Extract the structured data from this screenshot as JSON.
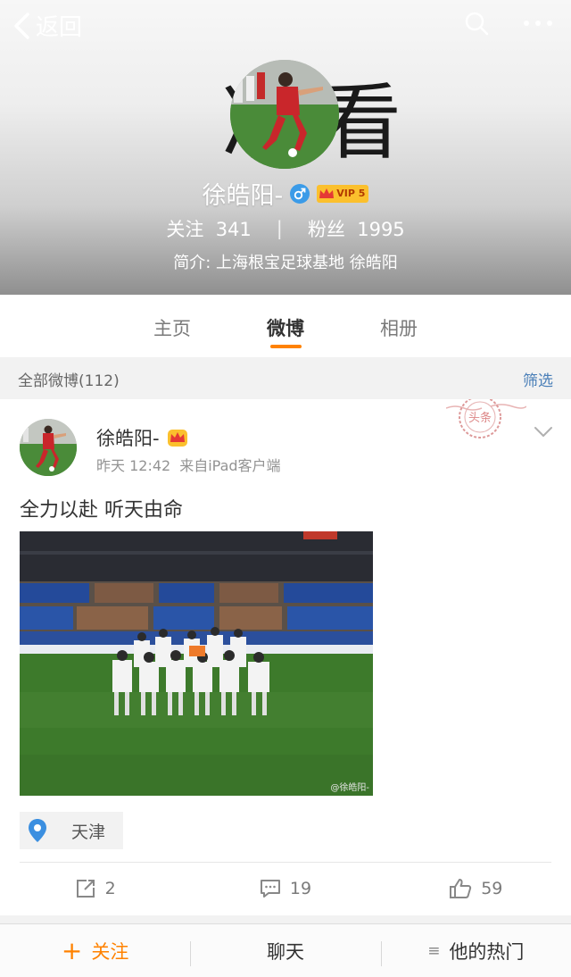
{
  "header": {
    "back_label": "返回",
    "bg_text": "准看",
    "name": "徐皓阳-",
    "vip_label": "VIP 5",
    "follow_label": "关注",
    "follow_count": "341",
    "fans_label": "粉丝",
    "fans_count": "1995",
    "bio": "简介: 上海根宝足球基地 徐皓阳"
  },
  "tabs": [
    {
      "label": "主页"
    },
    {
      "label": "微博"
    },
    {
      "label": "相册"
    }
  ],
  "filter": {
    "title": "全部微博(112)",
    "button": "筛选"
  },
  "post": {
    "author": "徐皓阳-",
    "time": "昨天 12:42",
    "source": "来自iPad客户端",
    "stamp_text": "头条",
    "text": "全力以赴 听天由命",
    "watermark": "@徐皓阳-",
    "location": "天津",
    "reposts": "2",
    "comments": "19",
    "likes": "59"
  },
  "bottom": {
    "follow_label": "关注",
    "chat_label": "聊天",
    "hot_label": "他的热门"
  },
  "colors": {
    "accent": "#ff8200",
    "link": "#4a7fb8",
    "gender": "#3b9be8",
    "vip": "#fbc02d"
  },
  "icons": [
    "back-arrow-icon",
    "search-icon",
    "more-icon",
    "male-icon",
    "crown-icon",
    "location-pin-icon",
    "repost-icon",
    "comment-icon",
    "like-icon",
    "chevron-down-icon",
    "list-icon"
  ]
}
